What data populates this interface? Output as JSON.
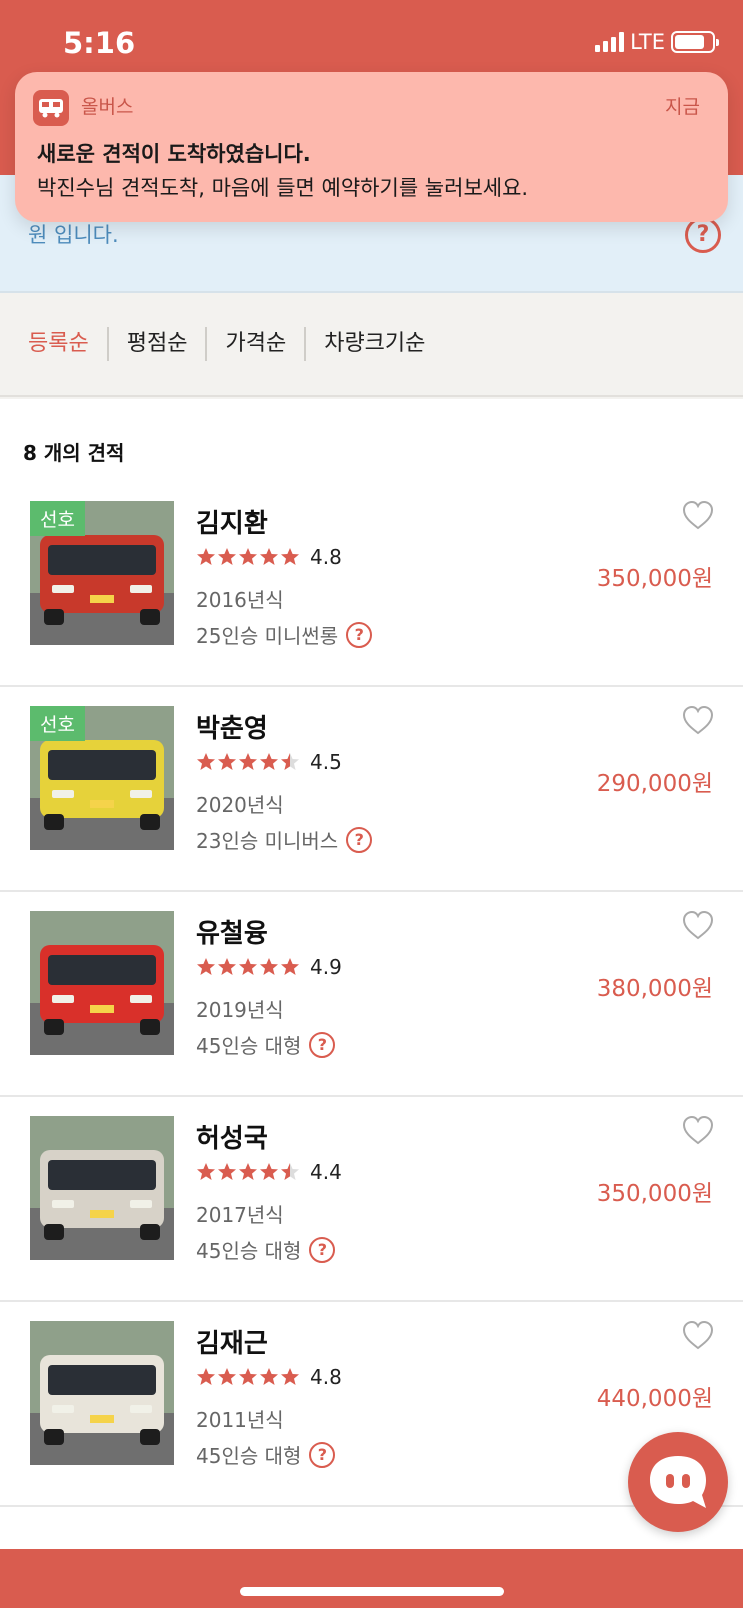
{
  "status_bar": {
    "time": "5:16",
    "network": "LTE",
    "signal_bars": 4,
    "battery_level": 0.8
  },
  "notification": {
    "app_name": "올버스",
    "time": "지금",
    "title": "새로운 견적이 도착하였습니다.",
    "body": "박진수님 견적도착, 마음에 들면 예약하기를 눌러보세요."
  },
  "info_banner": {
    "text_visible": "원 입니다.",
    "help_icon": "question-icon"
  },
  "sort_tabs": [
    {
      "label": "등록순",
      "active": true
    },
    {
      "label": "평점순",
      "active": false
    },
    {
      "label": "가격순",
      "active": false
    },
    {
      "label": "차량크기순",
      "active": false
    }
  ],
  "list": {
    "count_label": "8 개의 견적",
    "items": [
      {
        "name": "김지환",
        "rating": "4.8",
        "stars": 5,
        "year": "2016년식",
        "vehicle": "25인승 미니썬롱",
        "price": "350,000원",
        "preferred_label": "선호",
        "bus_color": "#c8392b"
      },
      {
        "name": "박춘영",
        "rating": "4.5",
        "stars": 4.5,
        "year": "2020년식",
        "vehicle": "23인승 미니버스",
        "price": "290,000원",
        "preferred_label": "선호",
        "bus_color": "#e6d23a"
      },
      {
        "name": "유철융",
        "rating": "4.9",
        "stars": 5,
        "year": "2019년식",
        "vehicle": "45인승 대형",
        "price": "380,000원",
        "preferred_label": "",
        "bus_color": "#d9302a"
      },
      {
        "name": "허성국",
        "rating": "4.4",
        "stars": 4.5,
        "year": "2017년식",
        "vehicle": "45인승 대형",
        "price": "350,000원",
        "preferred_label": "",
        "bus_color": "#d7d2c8"
      },
      {
        "name": "김재근",
        "rating": "4.8",
        "stars": 5,
        "year": "2011년식",
        "vehicle": "45인승 대형",
        "price": "440,000원",
        "preferred_label": "",
        "bus_color": "#e8e4da"
      }
    ]
  },
  "colors": {
    "accent": "#d95c4f",
    "preferred": "#5cbb6d",
    "info_text": "#4e8cbc"
  }
}
